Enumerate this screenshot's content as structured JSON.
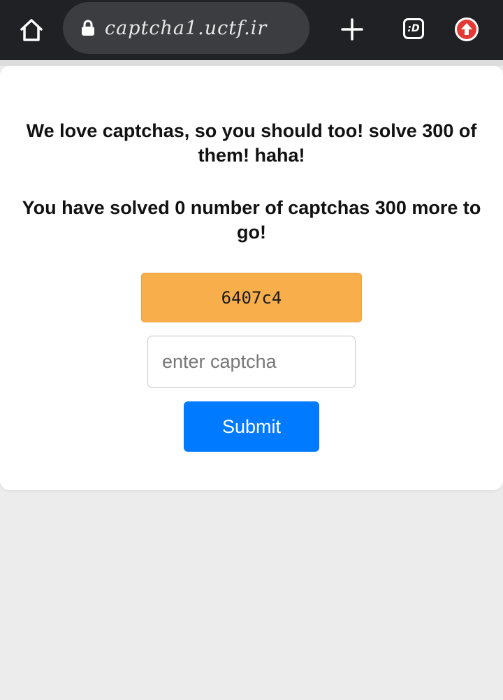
{
  "browser": {
    "url": "captcha1.uctf.ir",
    "tabs_badge": ":D",
    "icons": {
      "home": "home-icon",
      "lock": "lock-icon",
      "new_tab": "plus-icon",
      "tabs": "tabs-icon",
      "menu": "update-arrow-icon"
    },
    "colors": {
      "toolbar": "#202124",
      "url_pill": "#3c3d41",
      "menu_badge": "#e53935"
    }
  },
  "page": {
    "heading_line": "We love captchas, so you should too! solve 300 of them! haha!",
    "progress_line": "You have solved 0 number of captchas 300 more to go!",
    "captcha_code": "6407c4",
    "input_placeholder": "enter captcha",
    "submit_label": "Submit",
    "colors": {
      "captcha_bg": "#f7ae4b",
      "submit_bg": "#007bff",
      "page_bg": "#ececec"
    }
  }
}
